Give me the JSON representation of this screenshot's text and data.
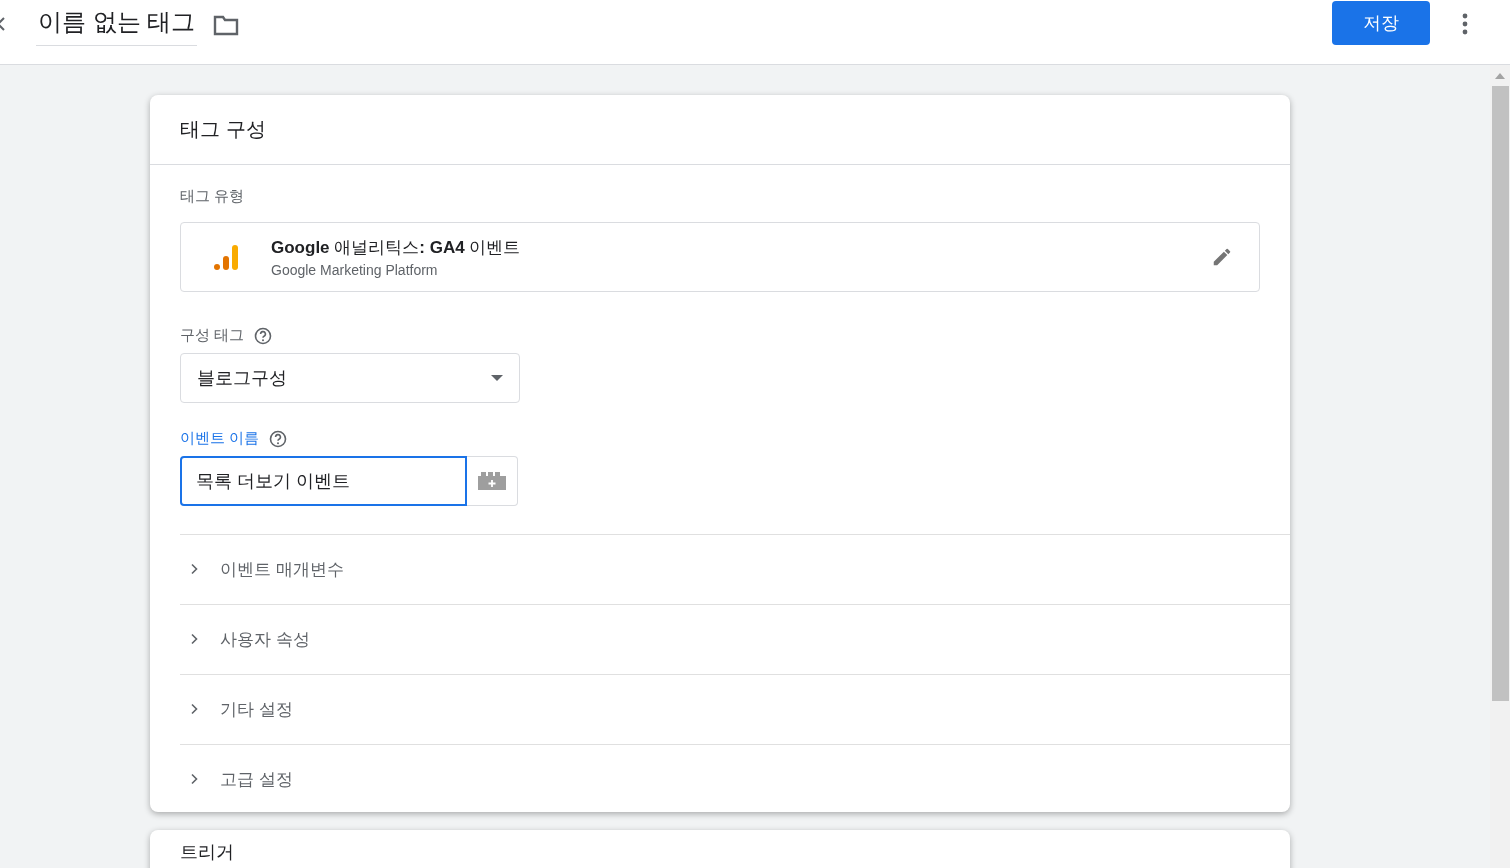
{
  "header": {
    "title": "이름 없는 태그",
    "save_button": "저장"
  },
  "tag_config": {
    "title": "태그 구성",
    "tag_type_label": "태그 유형",
    "tag_type": {
      "name": "**Google** 애널리틱스**: GA4** 이벤트",
      "provider": "Google Marketing Platform"
    },
    "config_tag": {
      "label": "구성 태그",
      "value": "블로그구성"
    },
    "event_name": {
      "label": "이벤트 이름",
      "value": "목록 더보기 이벤트",
      "focused": true
    },
    "sections": [
      {
        "label": "이벤트 매개변수",
        "expanded": false
      },
      {
        "label": "사용자 속성",
        "expanded": false
      },
      {
        "label": "기타 설정",
        "expanded": false
      },
      {
        "label": "고급 설정",
        "expanded": false
      }
    ]
  },
  "trigger": {
    "title": "트리거"
  }
}
